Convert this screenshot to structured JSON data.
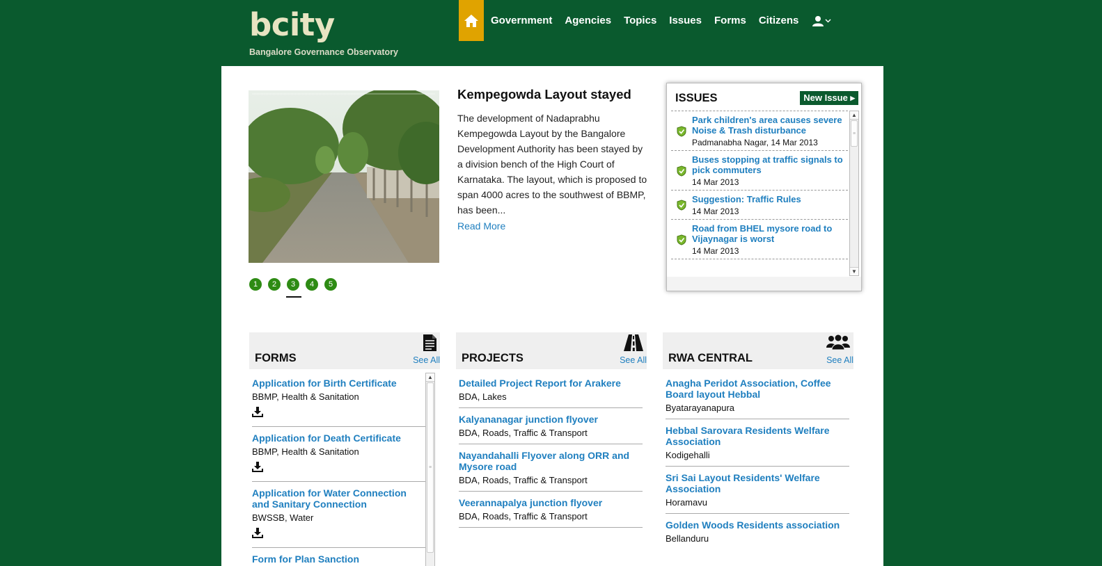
{
  "site": {
    "title": "bcity",
    "subtitle": "Bangalore Governance Observatory"
  },
  "nav": {
    "items": [
      "Government",
      "Agencies",
      "Topics",
      "Issues",
      "Forms",
      "Citizens"
    ]
  },
  "featured": {
    "headline": "Kempegowda Layout stayed",
    "body": "The development of Nadaprabhu Kempegowda Layout by the Bangalore Development Authority has been stayed by a division bench of the High Court of Karnataka. The layout, which is proposed to span 4000 acres to the southwest of BBMP, has been...",
    "read_more": "Read More",
    "pager": [
      "1",
      "2",
      "3",
      "4",
      "5"
    ],
    "active_page": "3"
  },
  "issues": {
    "title": "ISSUES",
    "new_button": "New Issue",
    "items": [
      {
        "title": "Park children's area causes severe Noise & Trash disturbance",
        "meta": "Padmanabha Nagar, 14 Mar 2013"
      },
      {
        "title": "Buses stopping at traffic signals to pick commuters",
        "meta": "14 Mar 2013"
      },
      {
        "title": "Suggestion: Traffic Rules",
        "meta": "14 Mar 2013"
      },
      {
        "title": "Road from BHEL mysore road to Vijaynagar is worst",
        "meta": "14 Mar 2013"
      }
    ]
  },
  "forms": {
    "title": "FORMS",
    "see_all": "See All",
    "items": [
      {
        "title": "Application for Birth Certificate",
        "meta": "BBMP, Health & Sanitation"
      },
      {
        "title": "Application for Death Certificate",
        "meta": "BBMP, Health & Sanitation"
      },
      {
        "title": "Application for Water Connection and Sanitary Connection",
        "meta": "BWSSB, Water"
      },
      {
        "title": "Form for Plan Sanction",
        "meta": ""
      }
    ]
  },
  "projects": {
    "title": "PROJECTS",
    "see_all": "See All",
    "items": [
      {
        "title": "Detailed Project Report for Arakere",
        "meta": "BDA, Lakes"
      },
      {
        "title": "Kalyananagar junction flyover",
        "meta": "BDA, Roads, Traffic & Transport"
      },
      {
        "title": "Nayandahalli Flyover along ORR and Mysore road",
        "meta": "BDA, Roads, Traffic & Transport"
      },
      {
        "title": "Veerannapalya junction flyover",
        "meta": "BDA, Roads, Traffic & Transport"
      }
    ]
  },
  "rwa": {
    "title": "RWA CENTRAL",
    "see_all": "See All",
    "items": [
      {
        "title": "Anagha Peridot Association, Coffee Board layout Hebbal",
        "meta": "Byatarayanapura"
      },
      {
        "title": "Hebbal Sarovara Residents Welfare Association",
        "meta": "Kodigehalli"
      },
      {
        "title": "Sri Sai Layout Residents' Welfare Association",
        "meta": "Horamavu"
      },
      {
        "title": "Golden Woods Residents association",
        "meta": "Bellanduru"
      }
    ]
  },
  "icons": {
    "home": "home-icon",
    "user": "user-icon",
    "issue_status": "shield-check-icon",
    "download": "download-icon",
    "forms": "document-icon",
    "projects": "road-icon",
    "rwa": "group-icon"
  },
  "colors": {
    "background": "#0a5a2e",
    "home_tab": "#e0a300",
    "link": "#1f7fbf",
    "pager": "#2e8b14",
    "new_issue": "#0b5a2e"
  }
}
